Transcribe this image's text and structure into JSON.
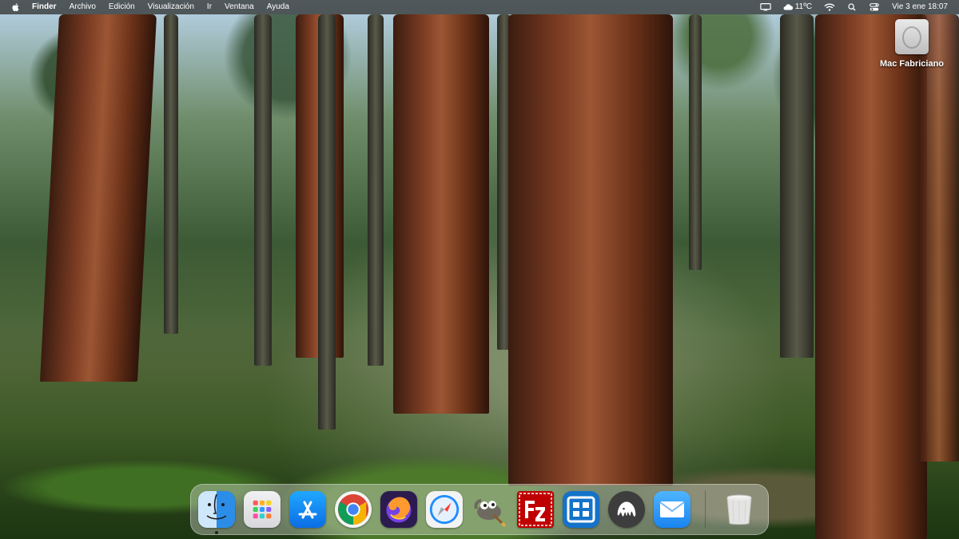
{
  "menubar": {
    "apple_icon": "apple-logo-icon",
    "app_name": "Finder",
    "menus": [
      "Archivo",
      "Edición",
      "Visualización",
      "Ir",
      "Ventana",
      "Ayuda"
    ],
    "status": {
      "weather": "11ºC",
      "clock": "Vie 3 ene  18:07",
      "icons": [
        "screen-mirroring-icon",
        "cloud-icon",
        "wifi-icon",
        "spotlight-search-icon",
        "control-center-icon"
      ]
    }
  },
  "desktop": {
    "drive_label": "Mac Fabriciano",
    "drive_icon": "hard-drive-icon"
  },
  "dock": {
    "apps": [
      {
        "name": "Finder",
        "icon": "finder-icon",
        "running": true
      },
      {
        "name": "Launchpad",
        "icon": "launchpad-icon",
        "running": false
      },
      {
        "name": "App Store",
        "icon": "app-store-icon",
        "running": false
      },
      {
        "name": "Google Chrome",
        "icon": "chrome-icon",
        "running": false
      },
      {
        "name": "Firefox",
        "icon": "firefox-icon",
        "running": false
      },
      {
        "name": "Safari",
        "icon": "safari-icon",
        "running": false
      },
      {
        "name": "GIMP",
        "icon": "gimp-icon",
        "running": false
      },
      {
        "name": "FileZilla",
        "icon": "filezilla-icon",
        "running": false
      },
      {
        "name": "Remote Desktop",
        "icon": "remote-desktop-icon",
        "running": false
      },
      {
        "name": "Sequel Pro",
        "icon": "sequel-pro-icon",
        "running": false
      },
      {
        "name": "Mail",
        "icon": "mail-icon",
        "running": false
      }
    ],
    "trash": {
      "name": "Papelera",
      "icon": "trash-icon"
    }
  },
  "colors": {
    "menubar_bg": "#282826",
    "accent_blue": "#1a84f0",
    "filezilla_red": "#bf0000"
  }
}
